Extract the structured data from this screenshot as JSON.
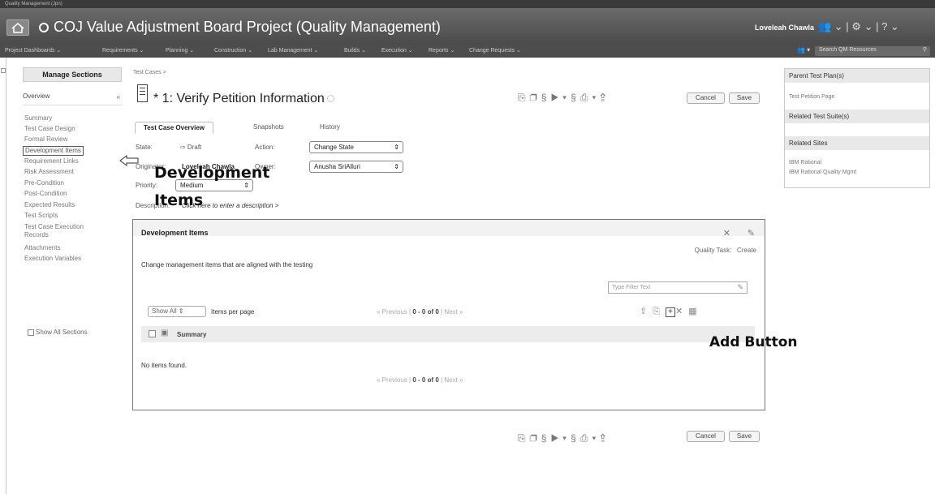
{
  "window": {
    "caption": "Quality Management (Jpn)"
  },
  "banner": {
    "title": "COJ Value Adjustment Board Project (Quality Management)",
    "user": "Loveleah Chawla"
  },
  "menubar": {
    "items": [
      "Project Dashboards ⌄",
      "Requirements ⌄",
      "Planning ⌄",
      "Construction ⌄",
      "Lab Management ⌄",
      "Builds ⌄",
      "Execution ⌄",
      "Reports ⌄",
      "Change Requests ⌄"
    ],
    "search_placeholder": "Search QM Resources"
  },
  "sidebar": {
    "manage_label": "Manage Sections",
    "overview_label": "Overview",
    "collapse_symbol": "«",
    "items": [
      "Summary",
      "Test Case Design",
      "Formal Review",
      "Development Items",
      "Requirement Links",
      "Risk Assessment",
      "Pre-Condition",
      "Post-Condition",
      "Expected Results",
      "Test Scripts",
      "Test Case Execution",
      "Records",
      "Attachments",
      "Execution Variables"
    ],
    "show_all_label": "Show All Sections"
  },
  "main": {
    "breadcrumb": "Test Cases >",
    "title": "* 1: Verify Petition Information",
    "cancel_label": "Cancel",
    "save_label": "Save",
    "tabs": [
      "Test Case Overview",
      "Snapshots",
      "History"
    ],
    "state_label": "State:",
    "state_value": "⇨ Draft",
    "action_label": "Action:",
    "action_value": "Change State",
    "originator_label": "Originator:",
    "originator_value": "Loveleah Chawla",
    "owner_label": "Owner:",
    "owner_value": "Anusha SriAlluri",
    "priority_label": "Priority:",
    "priority_value": "Medium",
    "description_label": "Description:",
    "description_link": "Click here to enter a description >"
  },
  "dev_panel": {
    "title": "Development Items",
    "quality_task_label": "Quality Task:",
    "create_label": "Create",
    "description": "Change management items that are aligned with the testing",
    "filter_placeholder": "Type Filter Text",
    "show_all_value": "Show All",
    "items_per_page_label": "Items per page",
    "pager_prev": "« Previous |",
    "pager_range": "0 - 0 of 0",
    "pager_next": "| Next »",
    "col_summary": "Summary",
    "empty_text": "No items found."
  },
  "right_panel": {
    "parent_plan_header": "Parent Test Plan(s)",
    "parent_plan_item": "Test Petition Page",
    "related_suites_header": "Related Test Suite(s)",
    "related_sites_header": "Related Sites",
    "related_sites": [
      "IBM Rational",
      "IBM Rational Quality Mgmt"
    ]
  },
  "annotations": {
    "dev_items_line1": "Development",
    "dev_items_line2": "Items",
    "add_button": "Add Button"
  }
}
